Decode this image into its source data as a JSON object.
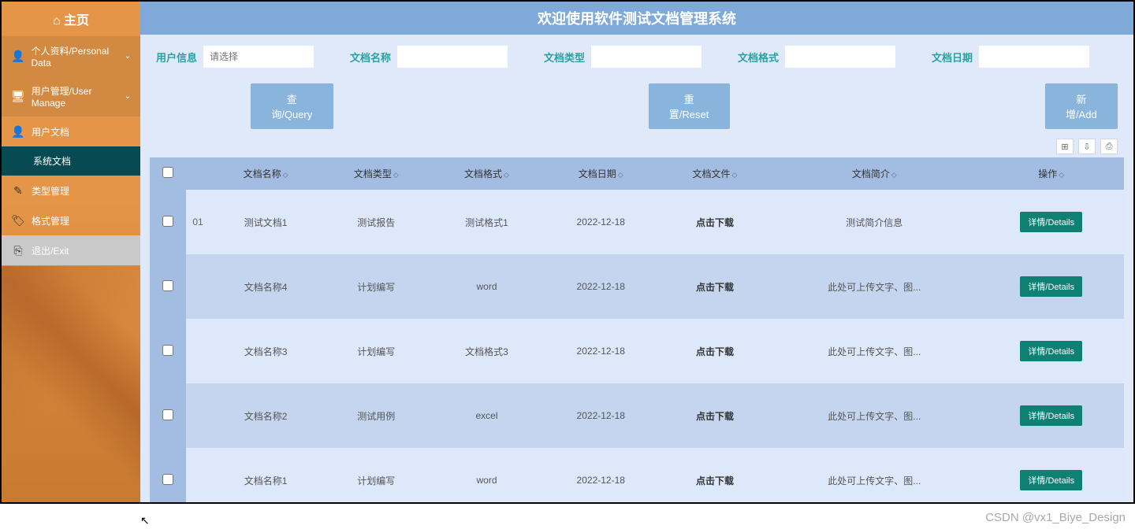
{
  "home_label": "⌂ 主页",
  "banner_title": "欢迎使用软件测试文档管理系统",
  "sidebar": {
    "items": [
      {
        "icon": "👤",
        "label": "个人资料/Personal Data",
        "chevron": "⌄"
      },
      {
        "icon": "🖥",
        "label": "用户管理/User Manage",
        "chevron": "⌄"
      },
      {
        "icon": "👤",
        "label": "用户文档"
      },
      {
        "icon": "",
        "label": "系统文档"
      },
      {
        "icon": "✎",
        "label": "类型管理"
      },
      {
        "icon": "🏷",
        "label": "格式管理"
      },
      {
        "icon": "⎘",
        "label": "退出/Exit"
      }
    ]
  },
  "search": {
    "fields": [
      {
        "label": "用户信息",
        "placeholder": "请选择"
      },
      {
        "label": "文档名称",
        "placeholder": ""
      },
      {
        "label": "文档类型",
        "placeholder": ""
      },
      {
        "label": "文档格式",
        "placeholder": ""
      },
      {
        "label": "文档日期",
        "placeholder": ""
      }
    ],
    "query_btn": "查询/Query",
    "reset_btn": "重置/Reset",
    "add_btn": "新增/Add"
  },
  "table": {
    "headers": [
      "",
      "",
      "",
      "文档名称",
      "文档类型",
      "文档格式",
      "文档日期",
      "文档文件",
      "文档简介",
      "操作"
    ],
    "rows": [
      {
        "idx": "01",
        "name": "测试文档1",
        "type": "测试报告",
        "format": "测试格式1",
        "date": "2022-12-18",
        "file": "点击下载",
        "desc": "测试简介信息",
        "action": "详情/Details"
      },
      {
        "idx": "",
        "name": "文档名称4",
        "type": "计划编写",
        "format": "word",
        "date": "2022-12-18",
        "file": "点击下载",
        "desc": "此处可上传文字、图...",
        "action": "详情/Details"
      },
      {
        "idx": "",
        "name": "文档名称3",
        "type": "计划编写",
        "format": "文档格式3",
        "date": "2022-12-18",
        "file": "点击下载",
        "desc": "此处可上传文字、图...",
        "action": "详情/Details"
      },
      {
        "idx": "",
        "name": "文档名称2",
        "type": "测试用例",
        "format": "excel",
        "date": "2022-12-18",
        "file": "点击下载",
        "desc": "此处可上传文字、图...",
        "action": "详情/Details"
      },
      {
        "idx": "",
        "name": "文档名称1",
        "type": "计划编写",
        "format": "word",
        "date": "2022-12-18",
        "file": "点击下载",
        "desc": "此处可上传文字、图...",
        "action": "详情/Details"
      }
    ]
  },
  "watermark": "CSDN @vx1_Biye_Design"
}
